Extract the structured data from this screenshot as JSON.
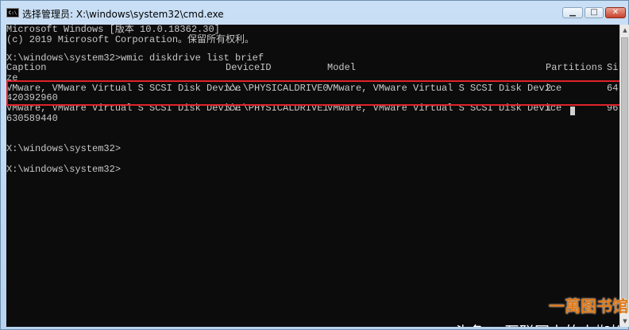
{
  "window": {
    "title": "选择管理员: X:\\windows\\system32\\cmd.exe",
    "icon": "cmd-icon"
  },
  "controls": {
    "minimize": "▁",
    "maximize": "□",
    "close": "✕"
  },
  "console": {
    "header1": "Microsoft Windows [版本 10.0.18362.30]",
    "header2": "(c) 2019 Microsoft Corporation。保留所有权利。",
    "command": "X:\\windows\\system32>wmic diskdrive list brief",
    "columns": {
      "caption": "Caption",
      "deviceid": "DeviceID",
      "model": "Model",
      "partitions": "Partitions",
      "size_head": "Si",
      "size_tail": "ze"
    },
    "rows": [
      {
        "caption": "VMware, VMware Virtual S SCSI Disk Device",
        "deviceid": "\\\\.\\PHYSICALDRIVE0",
        "model": "VMware, VMware Virtual S SCSI Disk Device",
        "partitions": "2",
        "size_head": "64",
        "size_tail": "420392960"
      },
      {
        "caption": "VMware, VMware Virtual S SCSI Disk Device",
        "deviceid": "\\\\.\\PHYSICALDRIVE1",
        "model": "VMware, VMware Virtual S SCSI Disk Device",
        "partitions": "1",
        "size_head": "96",
        "size_tail": "630589440"
      }
    ],
    "prompt1": "X:\\windows\\system32>",
    "prompt2": "X:\\windows\\system32>"
  },
  "watermark": {
    "text": "头条 @互联网上的小蜘蛛",
    "stamp": "一萬图书馆"
  },
  "colors": {
    "highlight": "#e0222b",
    "console_bg": "#0c0c0c",
    "console_text": "#c8c8c8"
  }
}
